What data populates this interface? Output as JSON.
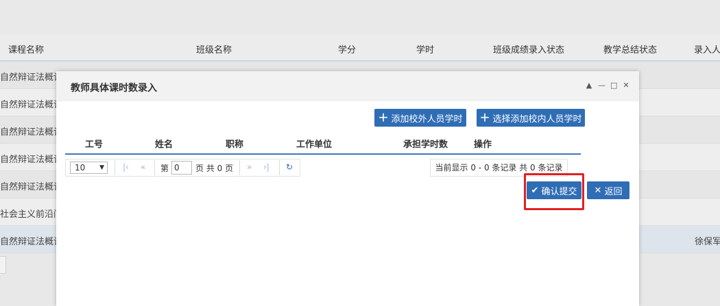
{
  "background_table": {
    "headers": [
      "课程名称",
      "班级名称",
      "学分",
      "学时",
      "班级成绩录入状态",
      "教学总结状态",
      "录入人"
    ],
    "rows": [
      {
        "course": "自然辩证法概论",
        "entry_person": ""
      },
      {
        "course": "自然辩证法概论",
        "entry_person": ""
      },
      {
        "course": "自然辩证法概论",
        "entry_person": ""
      },
      {
        "course": "自然辩证法概论",
        "entry_person": ""
      },
      {
        "course": "自然辩证法概论",
        "entry_person": ""
      },
      {
        "course": "社会主义前沿问",
        "entry_person": ""
      },
      {
        "course": "自然辩证法概论",
        "entry_person": "徐保军"
      }
    ]
  },
  "modal": {
    "title": "教师具体课时数录入",
    "window_controls": [
      "▲",
      "—",
      "□",
      "✕"
    ],
    "buttons": {
      "add_external": "添加校外人员学时",
      "add_internal": "选择添加校内人员学时",
      "confirm": "确认提交",
      "back": "返回"
    },
    "table_headers": [
      "工号",
      "姓名",
      "职称",
      "工作单位",
      "承担学时数",
      "操作"
    ],
    "pager": {
      "page_size": "10",
      "page_label": "第",
      "page_value": "0",
      "page_total_text": "页 共 0 页",
      "info": "当前显示 0 - 0 条记录 共 0 条记录"
    }
  },
  "icons": {
    "plus": "＋",
    "check": "✔",
    "close": "✕",
    "first": "|‹",
    "prev": "«",
    "next": "»",
    "last": "›|",
    "refresh": "↻"
  },
  "colors": {
    "primary": "#2f6db5",
    "highlight": "#e02020"
  }
}
